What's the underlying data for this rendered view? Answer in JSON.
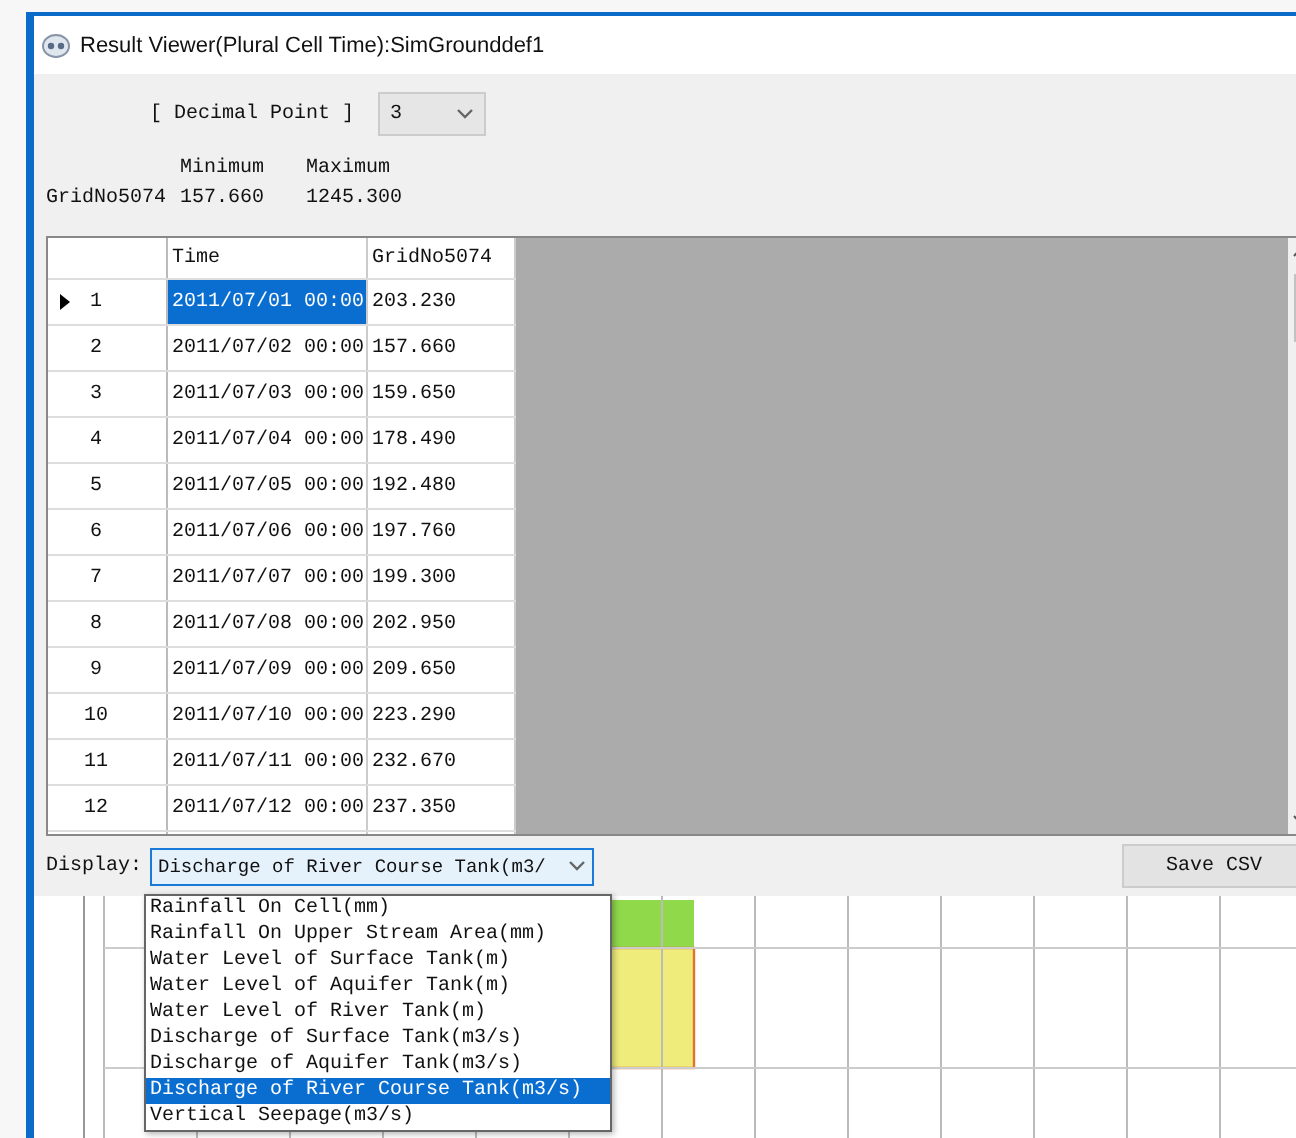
{
  "window": {
    "title": "Result Viewer(Plural Cell Time):SimGrounddef1"
  },
  "decimal_point": {
    "label": "[ Decimal Point ]",
    "value": "3"
  },
  "summary": {
    "columns": [
      "Minimum",
      "Maximum"
    ],
    "rows": [
      {
        "name": "GridNo5074",
        "values": [
          "157.660",
          "1245.300"
        ]
      }
    ]
  },
  "table": {
    "columns": [
      "Time",
      "GridNo5074"
    ],
    "rows": [
      {
        "index": "1",
        "time": "2011/07/01 00:00",
        "value": "203.230",
        "current": true,
        "selected": true
      },
      {
        "index": "2",
        "time": "2011/07/02 00:00",
        "value": "157.660",
        "current": false,
        "selected": false
      },
      {
        "index": "3",
        "time": "2011/07/03 00:00",
        "value": "159.650",
        "current": false,
        "selected": false
      },
      {
        "index": "4",
        "time": "2011/07/04 00:00",
        "value": "178.490",
        "current": false,
        "selected": false
      },
      {
        "index": "5",
        "time": "2011/07/05 00:00",
        "value": "192.480",
        "current": false,
        "selected": false
      },
      {
        "index": "6",
        "time": "2011/07/06 00:00",
        "value": "197.760",
        "current": false,
        "selected": false
      },
      {
        "index": "7",
        "time": "2011/07/07 00:00",
        "value": "199.300",
        "current": false,
        "selected": false
      },
      {
        "index": "8",
        "time": "2011/07/08 00:00",
        "value": "202.950",
        "current": false,
        "selected": false
      },
      {
        "index": "9",
        "time": "2011/07/09 00:00",
        "value": "209.650",
        "current": false,
        "selected": false
      },
      {
        "index": "10",
        "time": "2011/07/10 00:00",
        "value": "223.290",
        "current": false,
        "selected": false
      },
      {
        "index": "11",
        "time": "2011/07/11 00:00",
        "value": "232.670",
        "current": false,
        "selected": false
      },
      {
        "index": "12",
        "time": "2011/07/12 00:00",
        "value": "237.350",
        "current": false,
        "selected": false
      }
    ]
  },
  "display": {
    "label": "Display:",
    "value": "Discharge of River Course Tank(m3/",
    "expanded": true,
    "options": [
      {
        "label": "Rainfall On Cell(mm)",
        "selected": false
      },
      {
        "label": "Rainfall On Upper Stream Area(mm)",
        "selected": false
      },
      {
        "label": "Water Level of Surface Tank(m)",
        "selected": false
      },
      {
        "label": "Water Level of Aquifer Tank(m)",
        "selected": false
      },
      {
        "label": "Water Level of River Tank(m)",
        "selected": false
      },
      {
        "label": "Discharge of Surface Tank(m3/s)",
        "selected": false
      },
      {
        "label": "Discharge of Aquifer Tank(m3/s)",
        "selected": false
      },
      {
        "label": "Discharge of River Course Tank(m3/s)",
        "selected": true
      },
      {
        "label": "Vertical Seepage(m3/s)",
        "selected": false
      }
    ]
  },
  "buttons": [
    "Save CSV"
  ]
}
